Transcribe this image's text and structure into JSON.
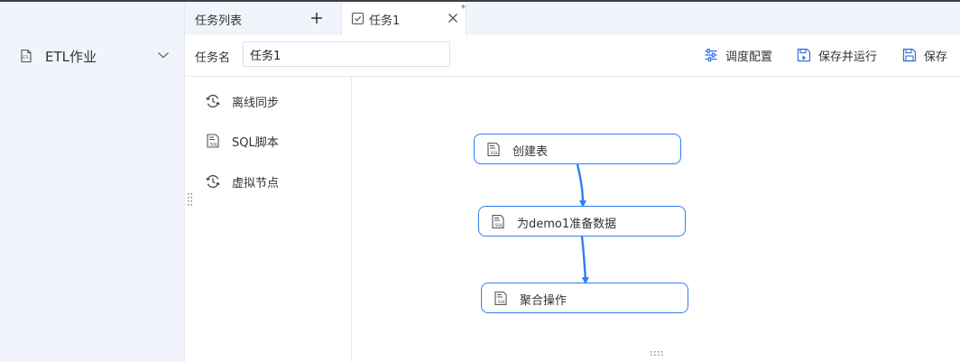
{
  "sidebar": {
    "item": {
      "label": "ETL作业",
      "icon": "etl-file-icon",
      "chevron": "chevron-down-icon"
    }
  },
  "tabs": [
    {
      "label": "任务列表",
      "icon": "plus-icon"
    },
    {
      "label": "任务1",
      "icon": "checkbox-doc-icon",
      "close_icon": "close-icon",
      "dirty_mark": "*"
    }
  ],
  "toolbar": {
    "name_label": "任务名",
    "name_value": "任务1",
    "schedule_label": "调度配置",
    "save_run_label": "保存并运行",
    "save_label": "保存"
  },
  "palette": {
    "items": [
      {
        "label": "离线同步",
        "icon": "sync-icon"
      },
      {
        "label": "SQL脚本",
        "icon": "sql-script-icon"
      },
      {
        "label": "虚拟节点",
        "icon": "virtual-node-icon"
      }
    ]
  },
  "canvas": {
    "nodes": [
      {
        "label": "创建表",
        "icon": "sql-script-icon"
      },
      {
        "label": "为demo1准备数据",
        "icon": "sql-script-icon"
      },
      {
        "label": "聚合操作",
        "icon": "sql-script-icon"
      }
    ]
  },
  "colors": {
    "accent": "#2f7ef5",
    "sidebar_bg": "#f1f4fb",
    "text": "#333333"
  }
}
